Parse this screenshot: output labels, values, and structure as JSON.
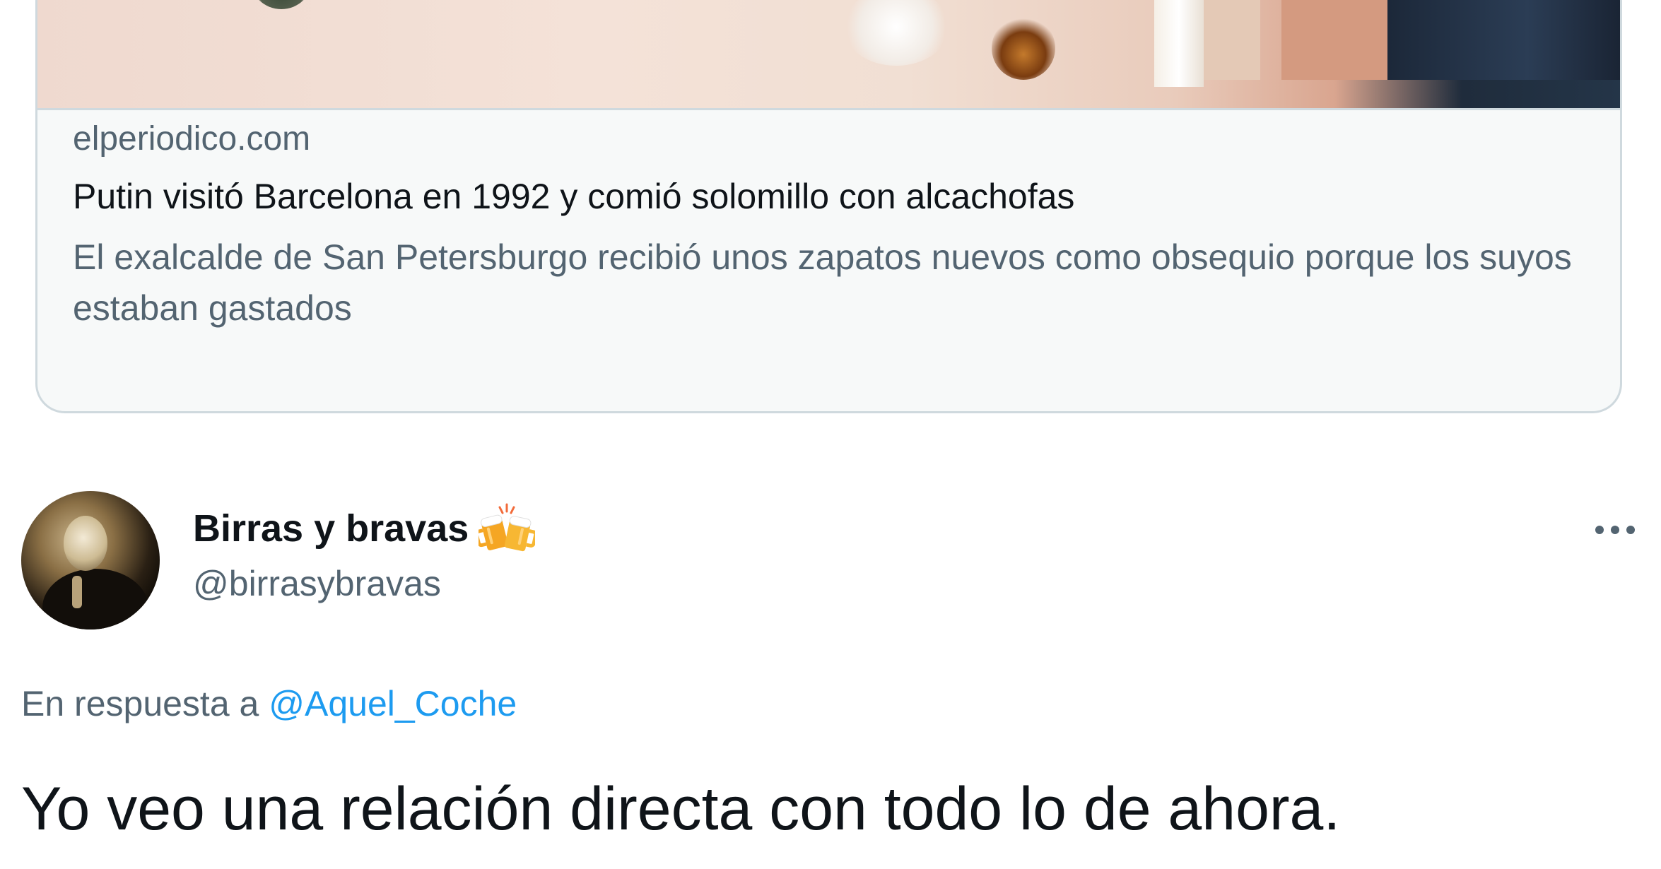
{
  "link_card": {
    "domain": "elperiodico.com",
    "title": "Putin visitó Barcelona en 1992 y comió solomillo con alcachofas",
    "description": "El exalcalde de San Petersburgo recibió unos zapatos nuevos como obsequio porque los suyos estaban gastados"
  },
  "tweet": {
    "display_name": "Birras y bravas",
    "display_name_emoji": "beer-mugs-icon",
    "handle": "@birrasybravas",
    "reply_prefix": "En respuesta a",
    "reply_mention": "@Aquel_Coche",
    "text": "Yo veo una relación directa con todo lo de ahora.",
    "more_icon": "more-dots-icon"
  },
  "colors": {
    "text_primary": "#0f1419",
    "text_secondary": "#536471",
    "link": "#1d9bf0",
    "border": "#cfd9de"
  }
}
